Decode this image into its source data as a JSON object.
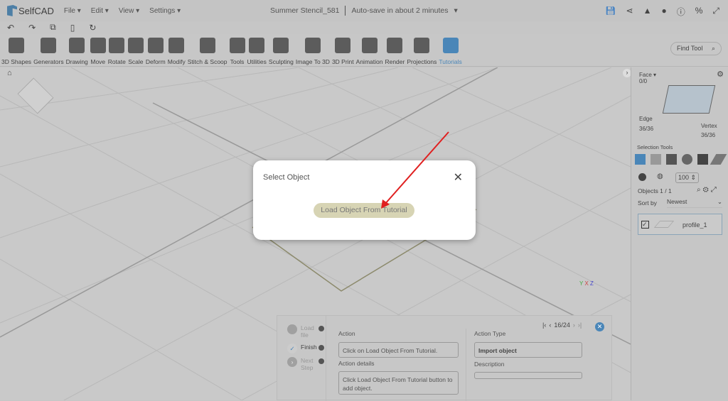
{
  "app": {
    "name": "SelfCAD",
    "menus": [
      "File",
      "Edit",
      "View",
      "Settings"
    ],
    "doc_title": "Summer Stencil_581",
    "autosave": "Auto-save in about 2 minutes"
  },
  "top_icons": [
    "save-icon",
    "share-icon",
    "bell-icon",
    "user-icon",
    "info-icon",
    "percent-icon",
    "fullscreen-icon"
  ],
  "quick": [
    "undo-icon",
    "redo-icon",
    "copy-icon",
    "delete-icon",
    "refresh-icon"
  ],
  "tools": [
    "3D Shapes",
    "Generators",
    "Drawing",
    "Move",
    "Rotate",
    "Scale",
    "Deform",
    "Modify",
    "Stitch & Scoop",
    "Tools",
    "Utilities",
    "Sculpting",
    "Image To 3D",
    "3D Print",
    "Animation",
    "Render",
    "Projections",
    "Tutorials"
  ],
  "find_tool": "Find Tool",
  "right": {
    "face_label": "Face",
    "face_count": "0/0",
    "edge_label": "Edge",
    "edge_count": "36/36",
    "vertex_label": "Vertex",
    "vertex_count": "36/36",
    "selection_tools": "Selection Tools",
    "size": "100",
    "objects": "Objects 1 / 1",
    "sort_by": "Sort by",
    "sort_value": "Newest",
    "object_name": "profile_1"
  },
  "modal": {
    "title": "Select Object",
    "button": "Load Object From Tutorial"
  },
  "tutorial": {
    "steps": [
      "Load file",
      "Finish",
      "Next Step"
    ],
    "page": "16/24",
    "action_label": "Action",
    "action": "Click on Load Object From Tutorial.",
    "details_label": "Action details",
    "details": "Click Load Object From Tutorial button to add object.",
    "type_label": "Action Type",
    "type": "Import object",
    "desc_label": "Description",
    "desc": ""
  },
  "colors": {
    "accent": "#4a86b8",
    "arrow": "#e02020"
  }
}
